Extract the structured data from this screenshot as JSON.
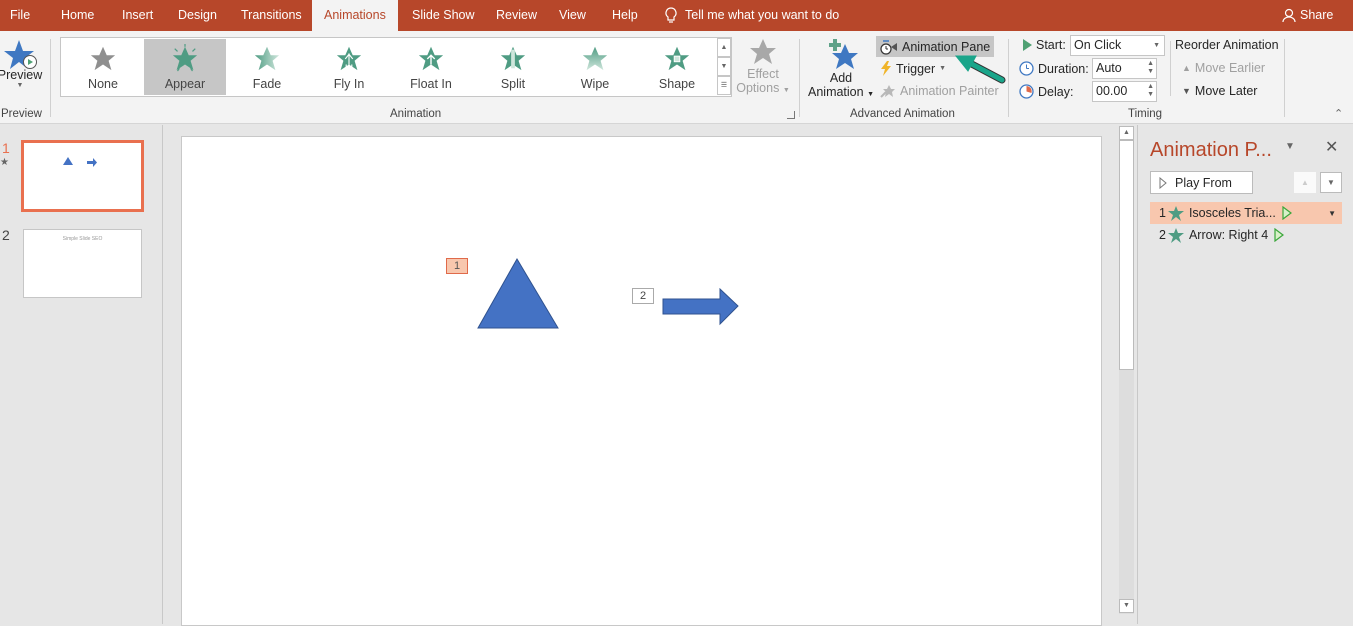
{
  "tabs": [
    {
      "label": "File",
      "active": false
    },
    {
      "label": "Home",
      "active": false
    },
    {
      "label": "Insert",
      "active": false
    },
    {
      "label": "Design",
      "active": false
    },
    {
      "label": "Transitions",
      "active": false
    },
    {
      "label": "Animations",
      "active": true
    },
    {
      "label": "Slide Show",
      "active": false
    },
    {
      "label": "Review",
      "active": false
    },
    {
      "label": "View",
      "active": false
    },
    {
      "label": "Help",
      "active": false
    }
  ],
  "tell_me": "Tell me what you want to do",
  "share": "Share",
  "ribbon": {
    "preview": {
      "button_label": "Preview",
      "group_label": "Preview"
    },
    "animation": {
      "group_label": "Animation",
      "gallery": [
        {
          "label": "None",
          "icon": "none-star-icon"
        },
        {
          "label": "Appear",
          "icon": "appear-star-icon",
          "selected": true
        },
        {
          "label": "Fade",
          "icon": "fade-star-icon"
        },
        {
          "label": "Fly In",
          "icon": "fly-in-star-icon"
        },
        {
          "label": "Float In",
          "icon": "float-in-star-icon"
        },
        {
          "label": "Split",
          "icon": "split-star-icon"
        },
        {
          "label": "Wipe",
          "icon": "wipe-star-icon"
        },
        {
          "label": "Shape",
          "icon": "shape-star-icon"
        }
      ],
      "effect_options_line1": "Effect",
      "effect_options_line2": "Options"
    },
    "advanced": {
      "group_label": "Advanced Animation",
      "add_animation_line1": "Add",
      "add_animation_line2": "Animation",
      "animation_pane": "Animation Pane",
      "trigger": "Trigger",
      "animation_painter": "Animation Painter"
    },
    "timing": {
      "group_label": "Timing",
      "start_label": "Start:",
      "start_value": "On Click",
      "duration_label": "Duration:",
      "duration_value": "Auto",
      "delay_label": "Delay:",
      "delay_value": "00.00",
      "reorder_title": "Reorder Animation",
      "move_earlier": "Move Earlier",
      "move_later": "Move Later"
    }
  },
  "slides": [
    {
      "number": "1",
      "selected": true,
      "has_animation": true
    },
    {
      "number": "2",
      "selected": false,
      "title_text": "Simple Slide SEO"
    }
  ],
  "canvas": {
    "tags": [
      "1",
      "2"
    ],
    "shape_color": "#4472c4"
  },
  "animation_pane": {
    "title": "Animation P...",
    "play_from": "Play From",
    "items": [
      {
        "index": "1",
        "name": "Isosceles Tria...",
        "selected": true
      },
      {
        "index": "2",
        "name": "Arrow: Right 4",
        "selected": false
      }
    ]
  },
  "colors": {
    "accent": "#b7472a",
    "selection": "#e9704f",
    "anim_selected": "#f8c7ae",
    "star_green": "#4f9c83"
  }
}
